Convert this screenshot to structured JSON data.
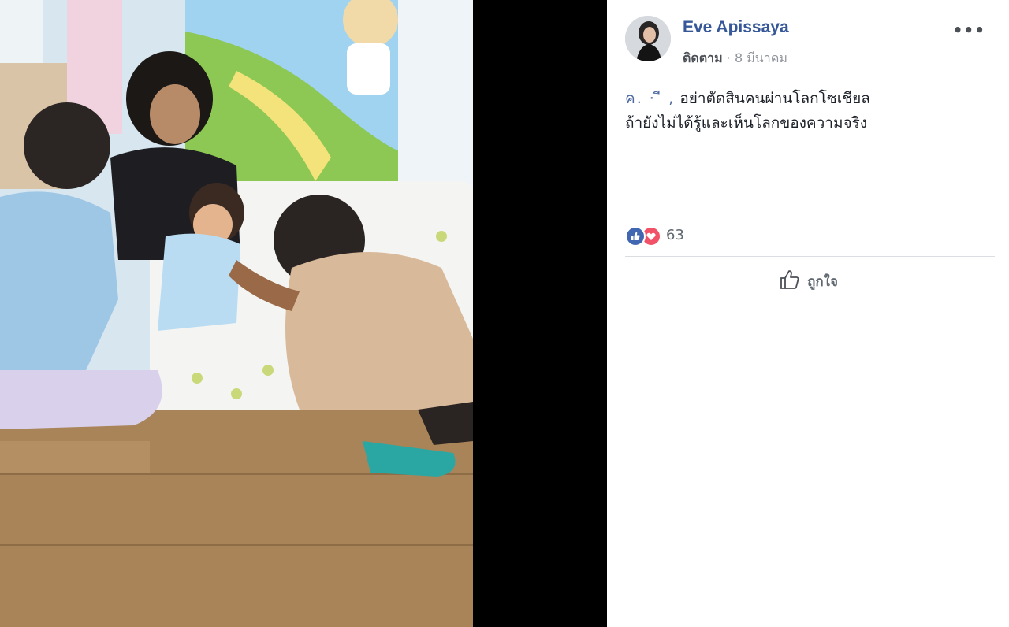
{
  "post": {
    "author": "Eve Apissaya",
    "follow_label": "ติดตาม",
    "separator": "·",
    "date": "8 มีนาคม",
    "more_label": "•••",
    "text_line1_prefix": "ค.",
    "text_line1_redacted": "  ·  ี  ,",
    "text_line1": "อย่าตัดสินคนผ่านโลกโซเชียล",
    "text_line2": "ถ้ายังไม่ได้รู้และเห็นโลกของความจริง",
    "reaction_count": "63",
    "like_button_label": "ถูกใจ"
  },
  "icons": {
    "like_reaction": "thumbs-up-icon",
    "love_reaction": "heart-icon",
    "like_button": "thumbs-up-outline-icon",
    "more": "ellipsis-icon"
  },
  "colors": {
    "author_link": "#365899",
    "like_blue": "#4267b2",
    "love_red": "#f25268",
    "photo_bg": "#000000"
  }
}
